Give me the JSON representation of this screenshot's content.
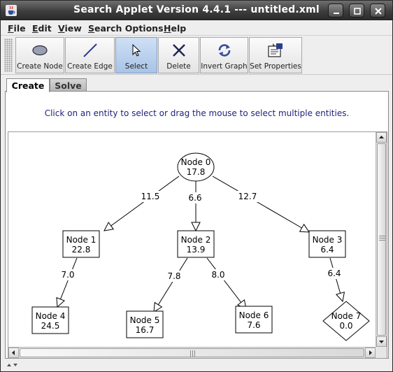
{
  "window": {
    "title": "Search Applet Version 4.4.1 --- untitled.xml",
    "controls": [
      "minimize",
      "maximize",
      "close"
    ]
  },
  "menu": [
    {
      "label": "File",
      "mnemonic": "F",
      "rest": "ile"
    },
    {
      "label": "Edit",
      "mnemonic": "E",
      "rest": "dit"
    },
    {
      "label": "View",
      "mnemonic": "V",
      "rest": "iew"
    },
    {
      "label": "Search Options",
      "mnemonic": "S",
      "rest": "earch Options"
    },
    {
      "label": "Help",
      "mnemonic": "H",
      "rest": "elp"
    }
  ],
  "toolbar": {
    "create_node": "Create Node",
    "create_edge": "Create Edge",
    "select": "Select",
    "delete": "Delete",
    "invert_graph": "Invert Graph",
    "set_properties": "Set Properties",
    "active": "Select"
  },
  "tabs": {
    "create": "Create",
    "solve": "Solve",
    "selected": "Create"
  },
  "hint": "Click on an entity to select or drag the mouse to select multiple entities.",
  "graph": {
    "nodes": [
      {
        "id": "n0",
        "name": "Node 0",
        "value": "17.8",
        "shape": "ellipse"
      },
      {
        "id": "n1",
        "name": "Node 1",
        "value": "22.8",
        "shape": "rect"
      },
      {
        "id": "n2",
        "name": "Node 2",
        "value": "13.9",
        "shape": "rect"
      },
      {
        "id": "n3",
        "name": "Node 3",
        "value": "6.4",
        "shape": "rect"
      },
      {
        "id": "n4",
        "name": "Node 4",
        "value": "24.5",
        "shape": "rect"
      },
      {
        "id": "n5",
        "name": "Node 5",
        "value": "16.7",
        "shape": "rect"
      },
      {
        "id": "n6",
        "name": "Node 6",
        "value": "7.6",
        "shape": "rect"
      },
      {
        "id": "n7",
        "name": "Node 7",
        "value": "0.0",
        "shape": "diamond"
      }
    ],
    "edges": [
      {
        "from": "n0",
        "to": "n1",
        "cost": "11.5"
      },
      {
        "from": "n0",
        "to": "n2",
        "cost": "6.6"
      },
      {
        "from": "n0",
        "to": "n3",
        "cost": "12.7"
      },
      {
        "from": "n1",
        "to": "n4",
        "cost": "7.0"
      },
      {
        "from": "n2",
        "to": "n5",
        "cost": "7.8"
      },
      {
        "from": "n2",
        "to": "n6",
        "cost": "8.0"
      },
      {
        "from": "n3",
        "to": "n7",
        "cost": "6.4"
      }
    ]
  },
  "colors": {
    "hint_text": "#22237a",
    "active_tool": "#a9c3e6"
  }
}
